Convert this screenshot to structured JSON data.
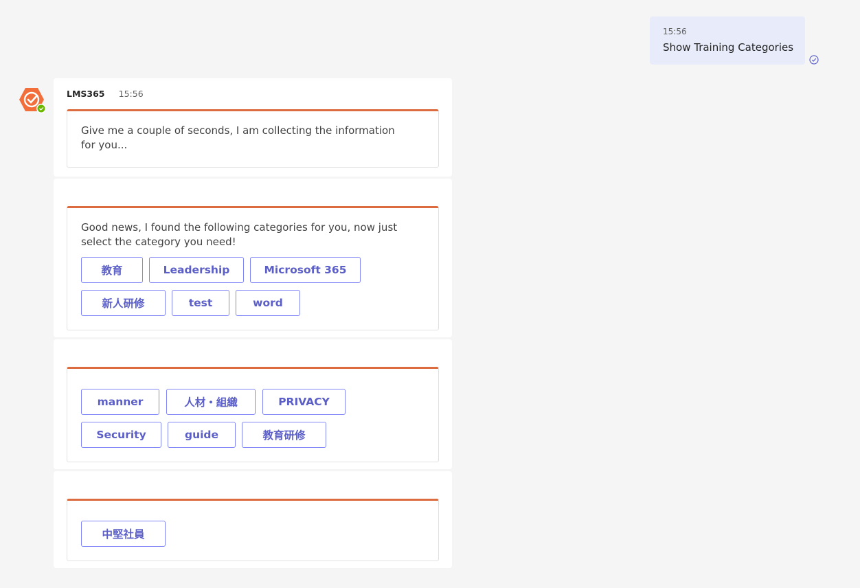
{
  "user_message": {
    "time": "15:56",
    "text": "Show Training Categories"
  },
  "bot": {
    "name": "LMS365",
    "time": "15:56",
    "accent_color": "#dc6b3f",
    "avatar_icon": "lms365-check-hexagon-icon"
  },
  "cards": {
    "loading_text": "Give me a couple of seconds, I am collecting the information for you...",
    "found_text": "Good news, I found the following categories for you, now just select the category you need!",
    "categories_1": [
      "教育",
      "Leadership",
      "Microsoft 365",
      "新人研修",
      "test",
      "word"
    ],
    "categories_2": [
      "manner",
      "人材・組織",
      "PRIVACY",
      "Security",
      "guide",
      "教育研修"
    ],
    "categories_3": [
      "中堅社員"
    ]
  }
}
